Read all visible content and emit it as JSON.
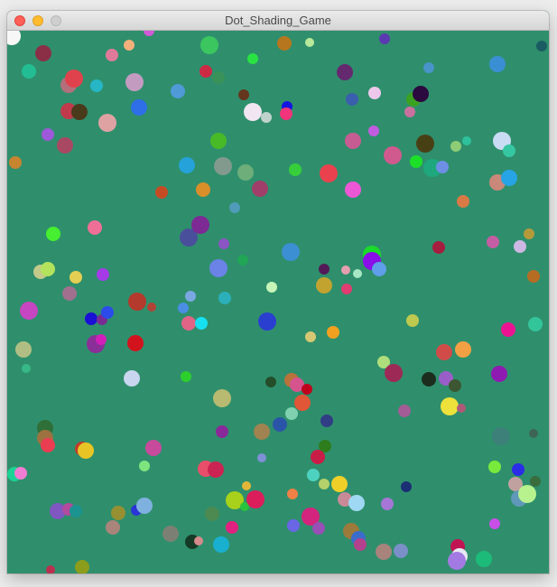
{
  "window": {
    "title": "Dot_Shading_Game",
    "background_color": "#2f8f6c"
  },
  "controls": {
    "close": "close-icon",
    "minimize": "minimize-icon",
    "maximize": "maximize-icon"
  },
  "palette": [
    "#2ecc71",
    "#e91e63",
    "#9b59b6",
    "#f1c40f",
    "#e67e22",
    "#3498db",
    "#1abc9c",
    "#c0392b",
    "#8e44ad",
    "#34495e"
  ]
}
